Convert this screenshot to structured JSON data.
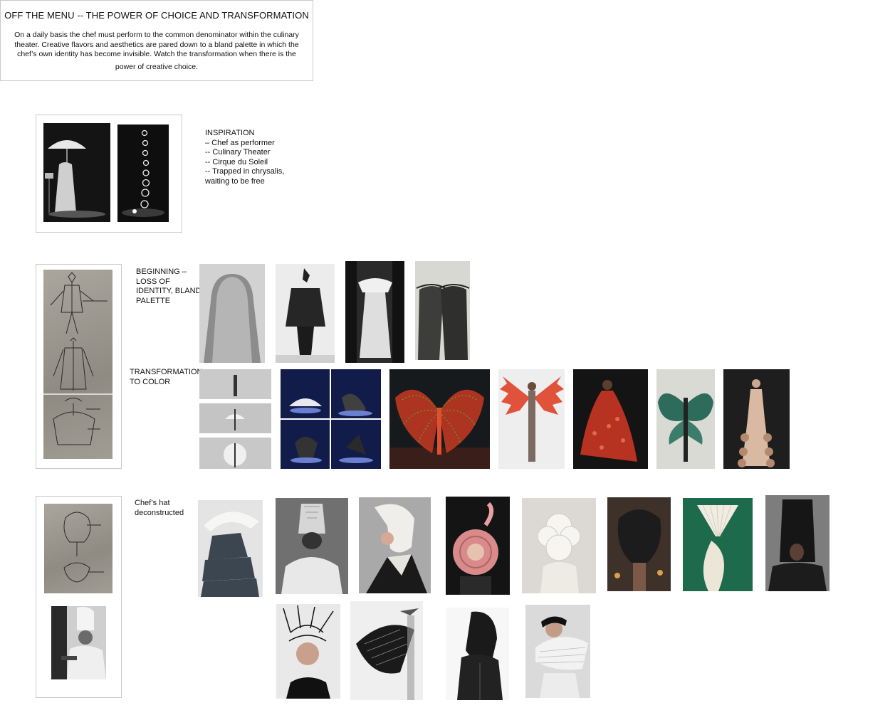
{
  "header": {
    "title": "OFF THE MENU -- THE POWER OF CHOICE AND TRANSFORMATION",
    "body": "On a daily basis the chef must perform to the common denominator within the culinary theater. Creative flavors and aesthetics are pared down to a bland palette in which the chef’s own identity has become invisible. Watch the transformation when there is the",
    "body_end": "power of creative choice."
  },
  "inspiration": {
    "heading": "INSPIRATION",
    "lines": [
      "– Chef as performer",
      "-- Culinary Theater",
      "-- Cirque du Soleil",
      "-- Trapped in chrysalis,",
      "waiting to be free"
    ]
  },
  "beginning": {
    "label": "BEGINNING –\nLOSS OF\nIDENTITY, BLAND\nPALETTE"
  },
  "transformation": {
    "label": "TRANSFORMATION\nTO COLOR"
  },
  "hat": {
    "label": "Chef’s hat\ndeconstructed"
  },
  "colors": {
    "border": "#c9c9c9",
    "sketch_paper": "#9e9a92",
    "wings_red": "#d9432e",
    "led_green": "#2f9e3a",
    "studio_green": "#1f6b4d",
    "stage_blue": "#1d2a6b"
  }
}
